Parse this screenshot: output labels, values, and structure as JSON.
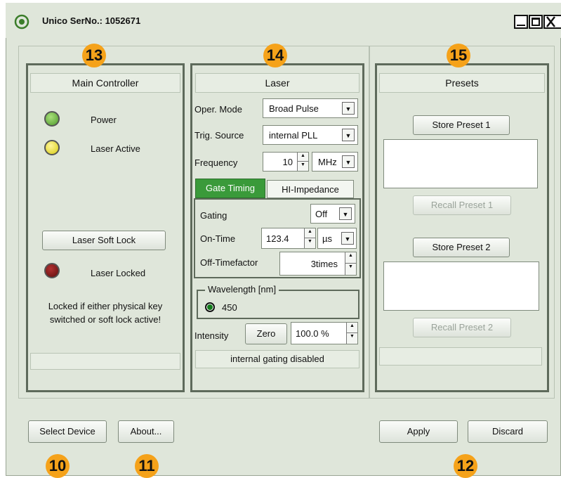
{
  "window": {
    "title": "Unico SerNo.: 1052671",
    "buttons": [
      "minimize",
      "maximize",
      "close"
    ]
  },
  "badges": {
    "main": "13",
    "laser": "14",
    "presets": "15",
    "select": "10",
    "about": "11",
    "apply": "12"
  },
  "main_controller": {
    "title": "Main Controller",
    "power_label": "Power",
    "laser_active_label": "Laser Active",
    "soft_lock_button": "Laser Soft Lock",
    "laser_locked_label": "Laser Locked",
    "note": "Locked if either physical key switched or soft lock active!",
    "status": ""
  },
  "laser": {
    "title": "Laser",
    "oper_mode_label": "Oper. Mode",
    "oper_mode_value": "Broad Pulse",
    "trig_source_label": "Trig. Source",
    "trig_source_value": "internal PLL",
    "frequency_label": "Frequency",
    "frequency_value": "10",
    "frequency_unit": "MHz",
    "tabs": [
      "Gate Timing",
      "HI-Impedance"
    ],
    "gating_label": "Gating",
    "gating_value": "Off",
    "on_time_label": "On-Time",
    "on_time_value": "123.4",
    "on_time_unit": "µs",
    "off_timefactor_label": "Off-Timefactor",
    "off_timefactor_value": "3times",
    "wavelength_title": "Wavelength [nm]",
    "wavelength_value": "450",
    "intensity_label": "Intensity",
    "zero_button": "Zero",
    "intensity_value": "100.0 %",
    "status": "internal gating disabled"
  },
  "presets": {
    "title": "Presets",
    "store1": "Store Preset 1",
    "recall1": "Recall Preset 1",
    "store2": "Store Preset 2",
    "recall2": "Recall Preset 2",
    "status": ""
  },
  "bottom": {
    "select_device": "Select Device",
    "about": "About...",
    "apply": "Apply",
    "discard": "Discard"
  },
  "colors": {
    "window_bg": "#dfe6da",
    "power_led": "#6db33f",
    "active_led": "#e6dc1a",
    "locked_led": "#7a1a1a",
    "accent_tab": "#3a9a3a",
    "badge": "#f5a21a"
  }
}
